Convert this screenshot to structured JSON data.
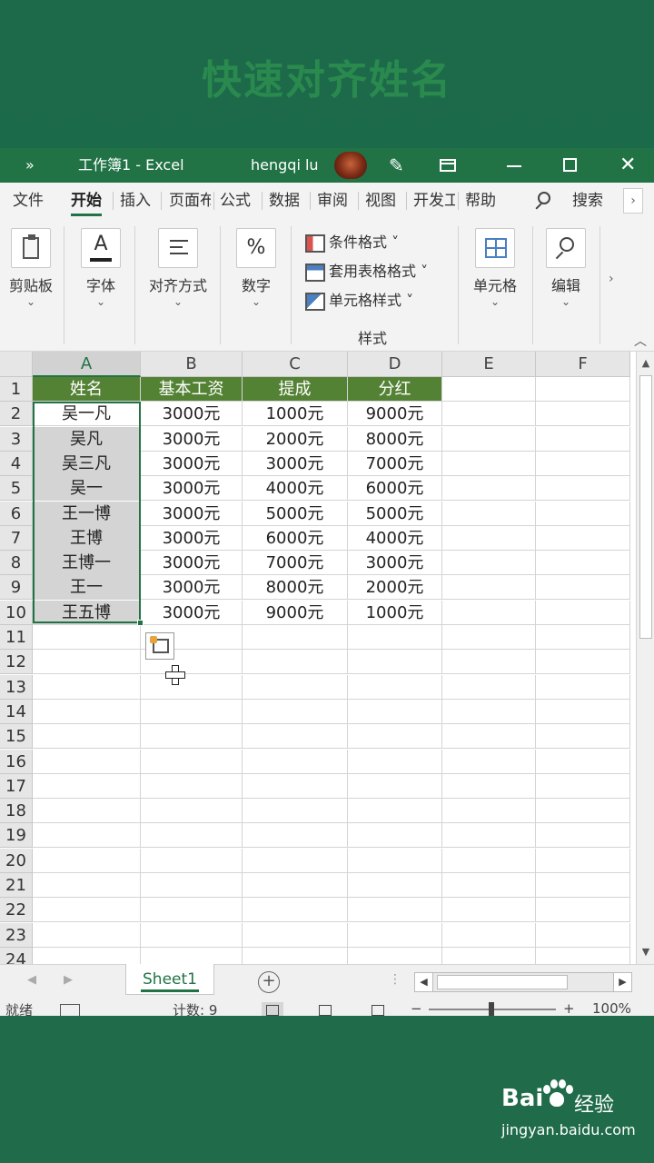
{
  "banner": {
    "title": "快速对齐姓名"
  },
  "titlebar": {
    "more": "»",
    "title": "工作簿1  -  Excel",
    "user": "hengqi lu"
  },
  "tabs": [
    "文件",
    "开始",
    "插入",
    "页面布",
    "公式",
    "数据",
    "审阅",
    "视图",
    "开发工",
    "帮助"
  ],
  "active_tab": "开始",
  "search_label": "搜索",
  "ribbon": {
    "clipboard": "剪贴板",
    "font": "字体",
    "alignment": "对齐方式",
    "number": "数字",
    "conditional_format": "条件格式 ˅",
    "table_format": "套用表格格式 ˅",
    "cell_styles": "单元格样式 ˅",
    "styles_group": "样式",
    "cells": "单元格",
    "editing": "编辑",
    "font_icon_letter": "A",
    "number_icon": "%"
  },
  "columns": [
    "A",
    "B",
    "C",
    "D",
    "E",
    "F"
  ],
  "rows": [
    "1",
    "2",
    "3",
    "4",
    "5",
    "6",
    "7",
    "8",
    "9",
    "10",
    "11",
    "12",
    "13",
    "14",
    "15",
    "16",
    "17",
    "18",
    "19",
    "20",
    "21",
    "22",
    "23",
    "24"
  ],
  "table": {
    "headers": [
      "姓名",
      "基本工资",
      "提成",
      "分红"
    ],
    "data": [
      [
        "吴一凡",
        "3000元",
        "1000元",
        "9000元"
      ],
      [
        "吴凡",
        "3000元",
        "2000元",
        "8000元"
      ],
      [
        "吴三凡",
        "3000元",
        "3000元",
        "7000元"
      ],
      [
        "吴一",
        "3000元",
        "4000元",
        "6000元"
      ],
      [
        "王一博",
        "3000元",
        "5000元",
        "5000元"
      ],
      [
        "王博",
        "3000元",
        "6000元",
        "4000元"
      ],
      [
        "王博一",
        "3000元",
        "7000元",
        "3000元"
      ],
      [
        "王一",
        "3000元",
        "8000元",
        "2000元"
      ],
      [
        "王五博",
        "3000元",
        "9000元",
        "1000元"
      ]
    ]
  },
  "sheet_tab": "Sheet1",
  "add_sheet": "+",
  "status": {
    "ready": "就绪",
    "count": "计数: 9",
    "minus": "−",
    "plus": "+",
    "zoom": "100%"
  },
  "watermark": {
    "brand": "Bai",
    "text": "经验",
    "url": "jingyan.baidu.com"
  },
  "colors": {
    "excel_green": "#217346",
    "header_fill": "#548235",
    "selection": "#d4d4d4"
  }
}
